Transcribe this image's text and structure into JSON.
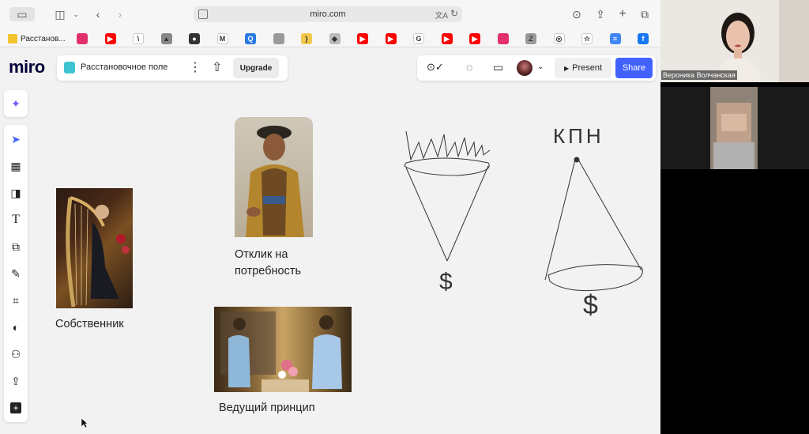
{
  "browser": {
    "url": "miro.com",
    "first_bookmark_label": "Расстанов...",
    "bookmark_icons": [
      {
        "name": "instagram-icon",
        "color": "#e1306c",
        "glyph": ""
      },
      {
        "name": "youtube-icon",
        "color": "#ff0000",
        "glyph": "▶"
      },
      {
        "name": "slash-icon",
        "color": "#ffffff",
        "glyph": "\\"
      },
      {
        "name": "mountain-icon",
        "color": "#888888",
        "glyph": "▲"
      },
      {
        "name": "circle-icon",
        "color": "#333333",
        "glyph": "●"
      },
      {
        "name": "gmail-icon",
        "color": "#ffffff",
        "glyph": "M"
      },
      {
        "name": "q-icon",
        "color": "#2a7ae2",
        "glyph": "Q"
      },
      {
        "name": "grey-square-icon",
        "color": "#9a9a9a",
        "glyph": ""
      },
      {
        "name": "bracket-icon",
        "color": "#f2c84b",
        "glyph": "}"
      },
      {
        "name": "diamond-icon",
        "color": "#bbbbbb",
        "glyph": "◆"
      },
      {
        "name": "youtube-icon",
        "color": "#ff0000",
        "glyph": "▶"
      },
      {
        "name": "youtube-icon",
        "color": "#ff0000",
        "glyph": "▶"
      },
      {
        "name": "google-icon",
        "color": "#ffffff",
        "glyph": "G"
      },
      {
        "name": "youtube-icon",
        "color": "#ff0000",
        "glyph": "▶"
      },
      {
        "name": "youtube-icon",
        "color": "#ff0000",
        "glyph": "▶"
      },
      {
        "name": "instagram-icon",
        "color": "#e1306c",
        "glyph": ""
      },
      {
        "name": "z-icon",
        "color": "#999999",
        "glyph": "Z"
      },
      {
        "name": "target-icon",
        "color": "#ffffff",
        "glyph": "◎"
      },
      {
        "name": "star-icon",
        "color": "#ffffff",
        "glyph": "☆"
      },
      {
        "name": "docs-icon",
        "color": "#4285f4",
        "glyph": "≡"
      },
      {
        "name": "facebook-icon",
        "color": "#1877f2",
        "glyph": "f"
      }
    ]
  },
  "miro": {
    "logo": "miro",
    "board_name": "Расстановочное поле",
    "upgrade_label": "Upgrade",
    "present_label": "Present",
    "share_label": "Share",
    "accent_color": "#4262ff"
  },
  "canvas": {
    "labels": {
      "owner": "Собственник",
      "response": "Отклик на\nпотребность",
      "leading": "Ведущий принцип"
    },
    "drawing_text": {
      "kpn": "КПН",
      "dollar1": "$",
      "dollar2": "$"
    }
  },
  "video": {
    "participant1_name": "Вероника Волчанская"
  }
}
